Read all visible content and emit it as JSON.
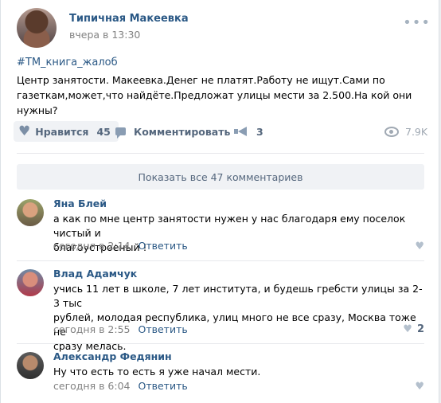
{
  "post": {
    "author": "Типичная Макеевка",
    "time": "вчера в 13:30",
    "hashtag": "#ТМ_книга_жалоб",
    "text_line1": "Центр занятости. Макеевка.Денег не платят.Работу не ищут.Сами по",
    "text_line2": "газеткам,может,что найдёте.Предложат улицы мести за 2.500.На кой они нужны?",
    "more_icon": "more-dots-icon"
  },
  "actions": {
    "like_label": "Нравится",
    "like_count": "45",
    "comment_label": "Комментировать",
    "share_count": "3",
    "views": "7.9K",
    "icons": [
      "heart-icon",
      "comment-icon",
      "share-icon",
      "eye-icon"
    ]
  },
  "show_all_comments": "Показать все 47 комментариев",
  "comments": [
    {
      "author": "Яна Блей",
      "line1": "а как по мне центр занятости нужен у нас благодаря ему поселок чистый и",
      "line2": "благоустроеный !",
      "line3": "",
      "time": "сегодня в 2:14",
      "reply": "Ответить",
      "likes": ""
    },
    {
      "author": "Влад Адамчук",
      "line1": "учись 11 лет в школе, 7 лет института, и будешь гребсти улицы за 2-3 тыс",
      "line2": "рублей, молодая республика, улиц много не все сразу, Москва тоже не",
      "line3": "сразу мелась.",
      "time": "сегодня в 2:55",
      "reply": "Ответить",
      "likes": "2"
    },
    {
      "author": "Александр Федянин",
      "line1": "Ну что есть то есть я уже начал мести.",
      "line2": "",
      "line3": "",
      "time": "сегодня в 6:04",
      "reply": "Ответить",
      "likes": ""
    }
  ],
  "colors": {
    "link": "#2a5885",
    "muted": "#828282",
    "action": "#55677d",
    "background": "#edeef0"
  }
}
